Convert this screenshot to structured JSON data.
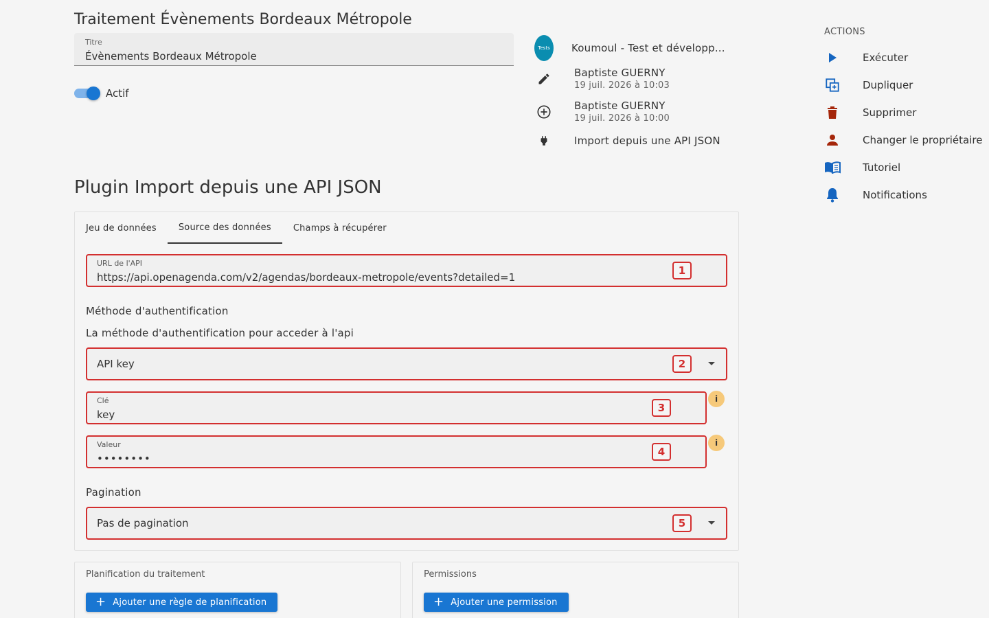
{
  "page": {
    "title": "Traitement Évènements Bordeaux Métropole"
  },
  "title_field": {
    "label": "Titre",
    "value": "Évènements Bordeaux Métropole"
  },
  "active_toggle": {
    "label": "Actif",
    "on": true
  },
  "info": {
    "owner_avatar_text": "Tests",
    "owner": "Koumoul - Test et développ...",
    "updated_by": "Baptiste GUERNY",
    "updated_at": "19 juil. 2026 à 10:03",
    "created_by": "Baptiste GUERNY",
    "created_at": "19 juil. 2026 à 10:00",
    "plugin": "Import depuis une API JSON"
  },
  "actions": {
    "heading": "ACTIONS",
    "items": [
      {
        "label": "Exécuter",
        "icon": "play-icon",
        "color": "#1565c0"
      },
      {
        "label": "Dupliquer",
        "icon": "duplicate-icon",
        "color": "#1565c0"
      },
      {
        "label": "Supprimer",
        "icon": "trash-icon",
        "color": "#a5260a"
      },
      {
        "label": "Changer le propriétaire",
        "icon": "person-icon",
        "color": "#a5260a"
      },
      {
        "label": "Tutoriel",
        "icon": "book-icon",
        "color": "#1565c0"
      },
      {
        "label": "Notifications",
        "icon": "bell-icon",
        "color": "#1565c0"
      }
    ]
  },
  "plugin_section": {
    "title": "Plugin Import depuis une API JSON",
    "tabs": [
      "Jeu de données",
      "Source des données",
      "Champs à récupérer"
    ],
    "active_tab": 1,
    "api_url": {
      "label": "URL de l'API",
      "value": "https://api.openagenda.com/v2/agendas/bordeaux-metropole/events?detailed=1",
      "marker": "1"
    },
    "auth_heading": "Méthode d'authentification",
    "auth_desc": "La méthode d'authentification pour acceder à l'api",
    "auth_method": {
      "value": "API key",
      "marker": "2"
    },
    "key_field": {
      "label": "Clé",
      "value": "key",
      "marker": "3"
    },
    "value_field": {
      "label": "Valeur",
      "value": "••••••••",
      "marker": "4"
    },
    "info_badge": "i",
    "pagination_heading": "Pagination",
    "pagination": {
      "value": "Pas de pagination",
      "marker": "5"
    }
  },
  "scheduling": {
    "title": "Planification du traitement",
    "button": "Ajouter une règle de planification"
  },
  "permissions": {
    "title": "Permissions",
    "button": "Ajouter une permission"
  },
  "colors": {
    "primary": "#1976d2",
    "error": "#d32f2f",
    "warning_badge": "#f6c97a",
    "danger_icon": "#a5260a"
  }
}
